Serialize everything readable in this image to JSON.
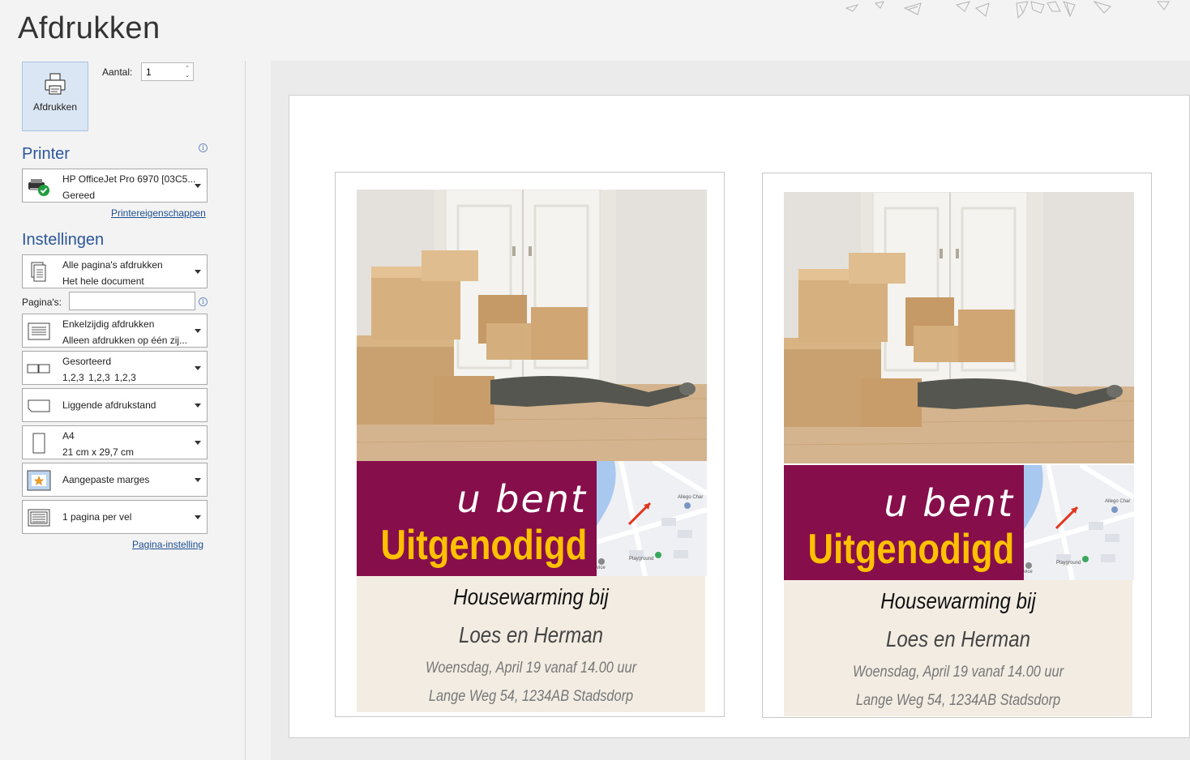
{
  "header": {
    "title": "Afdrukken"
  },
  "print_button": {
    "label": "Afdrukken"
  },
  "copies": {
    "label": "Aantal:",
    "value": "1"
  },
  "printer": {
    "heading": "Printer",
    "name": "HP OfficeJet Pro 6970 [03C5...",
    "status": "Gereed",
    "properties_link": "Printereigenschappen"
  },
  "settings": {
    "heading": "Instellingen",
    "pages_label": "Pagina's:",
    "pages_value": "",
    "items": [
      {
        "line1": "Alle pagina's afdrukken",
        "line2": "Het hele document"
      },
      {
        "line1": "Enkelzijdig afdrukken",
        "line2": "Alleen afdrukken op één zij..."
      },
      {
        "line1": "Gesorteerd",
        "line2": "1,2,3    1,2,3    1,2,3"
      },
      {
        "line1": "Liggende afdrukstand"
      },
      {
        "line1": "A4",
        "line2": "21 cm x 29,7 cm"
      },
      {
        "line1": "Aangepaste marges"
      },
      {
        "line1": "1 pagina per vel"
      }
    ],
    "page_setup_link": "Pagina-instelling"
  },
  "invitation": {
    "line_a": "u bent",
    "line_b": "Uitgenodigd",
    "event": "Housewarming bij",
    "hosts": "Loes en Herman",
    "date": "Woensdag, April 19 vanaf 14.00 uur",
    "address": "Lange Weg 54, 1234AB Stadsdorp",
    "map_label_1": "Allego Char",
    "map_label_2": "Playground",
    "map_label_3": "vice"
  },
  "colors": {
    "accent": "#2b579a",
    "card_purple": "#850e4b",
    "card_yellow": "#ffc000",
    "card_beige": "#f2ece3"
  }
}
